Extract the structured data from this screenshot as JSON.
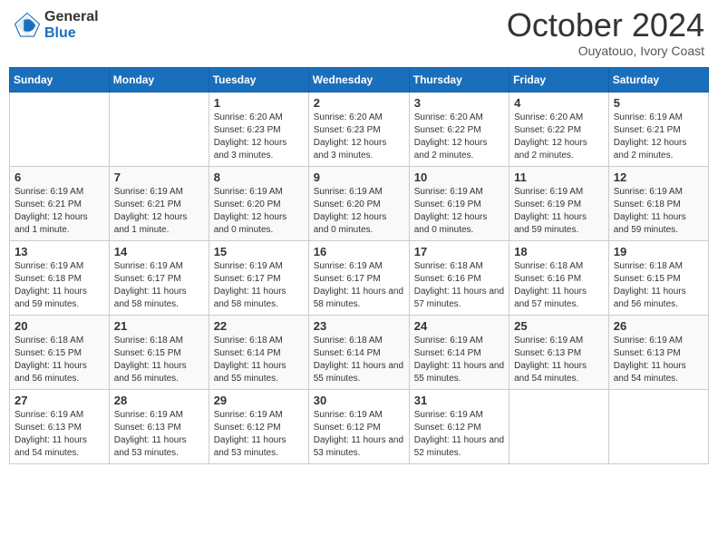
{
  "logo": {
    "text_general": "General",
    "text_blue": "Blue"
  },
  "header": {
    "month": "October 2024",
    "location": "Ouyatouo, Ivory Coast"
  },
  "weekdays": [
    "Sunday",
    "Monday",
    "Tuesday",
    "Wednesday",
    "Thursday",
    "Friday",
    "Saturday"
  ],
  "weeks": [
    [
      {
        "day": "",
        "info": ""
      },
      {
        "day": "",
        "info": ""
      },
      {
        "day": "1",
        "info": "Sunrise: 6:20 AM\nSunset: 6:23 PM\nDaylight: 12 hours and 3 minutes."
      },
      {
        "day": "2",
        "info": "Sunrise: 6:20 AM\nSunset: 6:23 PM\nDaylight: 12 hours and 3 minutes."
      },
      {
        "day": "3",
        "info": "Sunrise: 6:20 AM\nSunset: 6:22 PM\nDaylight: 12 hours and 2 minutes."
      },
      {
        "day": "4",
        "info": "Sunrise: 6:20 AM\nSunset: 6:22 PM\nDaylight: 12 hours and 2 minutes."
      },
      {
        "day": "5",
        "info": "Sunrise: 6:19 AM\nSunset: 6:21 PM\nDaylight: 12 hours and 2 minutes."
      }
    ],
    [
      {
        "day": "6",
        "info": "Sunrise: 6:19 AM\nSunset: 6:21 PM\nDaylight: 12 hours and 1 minute."
      },
      {
        "day": "7",
        "info": "Sunrise: 6:19 AM\nSunset: 6:21 PM\nDaylight: 12 hours and 1 minute."
      },
      {
        "day": "8",
        "info": "Sunrise: 6:19 AM\nSunset: 6:20 PM\nDaylight: 12 hours and 0 minutes."
      },
      {
        "day": "9",
        "info": "Sunrise: 6:19 AM\nSunset: 6:20 PM\nDaylight: 12 hours and 0 minutes."
      },
      {
        "day": "10",
        "info": "Sunrise: 6:19 AM\nSunset: 6:19 PM\nDaylight: 12 hours and 0 minutes."
      },
      {
        "day": "11",
        "info": "Sunrise: 6:19 AM\nSunset: 6:19 PM\nDaylight: 11 hours and 59 minutes."
      },
      {
        "day": "12",
        "info": "Sunrise: 6:19 AM\nSunset: 6:18 PM\nDaylight: 11 hours and 59 minutes."
      }
    ],
    [
      {
        "day": "13",
        "info": "Sunrise: 6:19 AM\nSunset: 6:18 PM\nDaylight: 11 hours and 59 minutes."
      },
      {
        "day": "14",
        "info": "Sunrise: 6:19 AM\nSunset: 6:17 PM\nDaylight: 11 hours and 58 minutes."
      },
      {
        "day": "15",
        "info": "Sunrise: 6:19 AM\nSunset: 6:17 PM\nDaylight: 11 hours and 58 minutes."
      },
      {
        "day": "16",
        "info": "Sunrise: 6:19 AM\nSunset: 6:17 PM\nDaylight: 11 hours and 58 minutes."
      },
      {
        "day": "17",
        "info": "Sunrise: 6:18 AM\nSunset: 6:16 PM\nDaylight: 11 hours and 57 minutes."
      },
      {
        "day": "18",
        "info": "Sunrise: 6:18 AM\nSunset: 6:16 PM\nDaylight: 11 hours and 57 minutes."
      },
      {
        "day": "19",
        "info": "Sunrise: 6:18 AM\nSunset: 6:15 PM\nDaylight: 11 hours and 56 minutes."
      }
    ],
    [
      {
        "day": "20",
        "info": "Sunrise: 6:18 AM\nSunset: 6:15 PM\nDaylight: 11 hours and 56 minutes."
      },
      {
        "day": "21",
        "info": "Sunrise: 6:18 AM\nSunset: 6:15 PM\nDaylight: 11 hours and 56 minutes."
      },
      {
        "day": "22",
        "info": "Sunrise: 6:18 AM\nSunset: 6:14 PM\nDaylight: 11 hours and 55 minutes."
      },
      {
        "day": "23",
        "info": "Sunrise: 6:18 AM\nSunset: 6:14 PM\nDaylight: 11 hours and 55 minutes."
      },
      {
        "day": "24",
        "info": "Sunrise: 6:19 AM\nSunset: 6:14 PM\nDaylight: 11 hours and 55 minutes."
      },
      {
        "day": "25",
        "info": "Sunrise: 6:19 AM\nSunset: 6:13 PM\nDaylight: 11 hours and 54 minutes."
      },
      {
        "day": "26",
        "info": "Sunrise: 6:19 AM\nSunset: 6:13 PM\nDaylight: 11 hours and 54 minutes."
      }
    ],
    [
      {
        "day": "27",
        "info": "Sunrise: 6:19 AM\nSunset: 6:13 PM\nDaylight: 11 hours and 54 minutes."
      },
      {
        "day": "28",
        "info": "Sunrise: 6:19 AM\nSunset: 6:13 PM\nDaylight: 11 hours and 53 minutes."
      },
      {
        "day": "29",
        "info": "Sunrise: 6:19 AM\nSunset: 6:12 PM\nDaylight: 11 hours and 53 minutes."
      },
      {
        "day": "30",
        "info": "Sunrise: 6:19 AM\nSunset: 6:12 PM\nDaylight: 11 hours and 53 minutes."
      },
      {
        "day": "31",
        "info": "Sunrise: 6:19 AM\nSunset: 6:12 PM\nDaylight: 11 hours and 52 minutes."
      },
      {
        "day": "",
        "info": ""
      },
      {
        "day": "",
        "info": ""
      }
    ]
  ]
}
